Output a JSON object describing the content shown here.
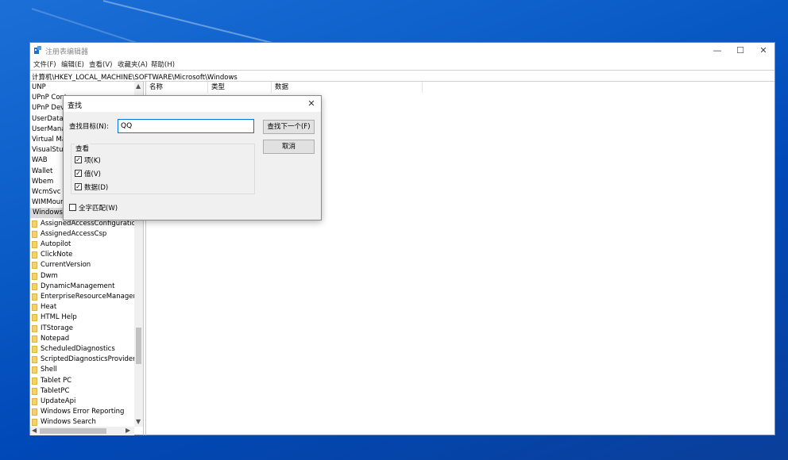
{
  "window": {
    "title": "注册表编辑器",
    "minimize_label": "—",
    "maximize_label": "☐",
    "close_label": "✕"
  },
  "menu": [
    "文件(F)",
    "编辑(E)",
    "查看(V)",
    "收藏夹(A)",
    "帮助(H)"
  ],
  "address": "计算机\\HKEY_LOCAL_MACHINE\\SOFTWARE\\Microsoft\\Windows",
  "tree": {
    "top_items": [
      "UNP",
      "UPnP Cont",
      "UPnP Devi",
      "UserData",
      "UserMana",
      "Virtual Ma",
      "VisualStud",
      "WAB",
      "Wallet",
      "Wbem",
      "WcmSvc",
      "WIMMour"
    ],
    "selected": "Windows",
    "children": [
      "AssignedAccessConfiguration",
      "AssignedAccessCsp",
      "Autopilot",
      "ClickNote",
      "CurrentVersion",
      "Dwm",
      "DynamicManagement",
      "EnterpriseResourceManager",
      "Heat",
      "HTML Help",
      "ITStorage",
      "Notepad",
      "ScheduledDiagnostics",
      "ScriptedDiagnosticsProvider",
      "Shell",
      "Tablet PC",
      "TabletPC",
      "UpdateApi",
      "Windows Error Reporting",
      "Windows Search"
    ]
  },
  "columns": [
    "名称",
    "类型",
    "数据"
  ],
  "dialog": {
    "title": "查找",
    "close_label": "✕",
    "find_label": "查找目标(N):",
    "find_value": "QQ",
    "find_next_button": "查找下一个(F)",
    "cancel_button": "取消",
    "look_at_label": "查看",
    "options": [
      {
        "label": "项(K)",
        "checked": true
      },
      {
        "label": "值(V)",
        "checked": true
      },
      {
        "label": "数据(D)",
        "checked": true
      }
    ],
    "match_whole": {
      "label": "全字匹配(W)",
      "checked": false
    }
  },
  "colors": {
    "accent": "#0078d7",
    "desktop": "#0a5bc6",
    "folder": "#f3d26b"
  }
}
